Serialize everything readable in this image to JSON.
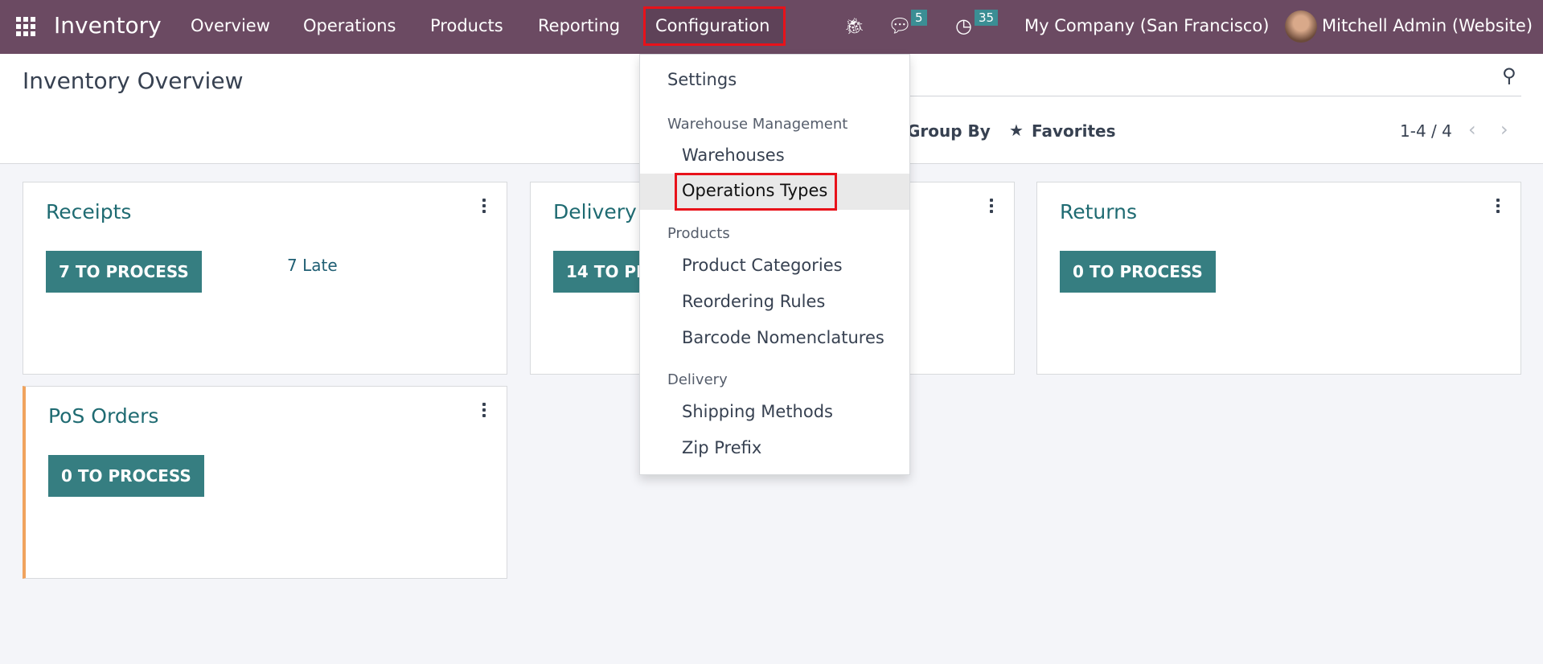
{
  "navbar": {
    "app_name": "Inventory",
    "menu": [
      "Overview",
      "Operations",
      "Products",
      "Reporting",
      "Configuration"
    ],
    "messages_count": "5",
    "activities_count": "35",
    "company": "My Company (San Francisco)",
    "user": "Mitchell Admin (Website)",
    "color": "#6b4a62"
  },
  "control_panel": {
    "title": "Inventory Overview",
    "group_by": "Group By",
    "favorites": "Favorites",
    "pager": "1-4 / 4"
  },
  "cards": [
    {
      "title": "Receipts",
      "button": "7 TO PROCESS",
      "late": "7 Late"
    },
    {
      "title": "Delivery",
      "button": "14 TO PROCESS"
    },
    {
      "title": "Returns",
      "button": "0 TO PROCESS"
    },
    {
      "title": "PoS Orders",
      "button": "0 TO PROCESS"
    }
  ],
  "dropdown": {
    "settings": "Settings",
    "warehouse_header": "Warehouse Management",
    "warehouses": "Warehouses",
    "operations_types": "Operations Types",
    "products_header": "Products",
    "product_categories": "Product Categories",
    "reordering_rules": "Reordering Rules",
    "barcode": "Barcode Nomenclatures",
    "delivery_header": "Delivery",
    "shipping_methods": "Shipping Methods",
    "zip_prefix": "Zip Prefix"
  },
  "accent": "#367e81",
  "highlight_color": "#e8121a"
}
